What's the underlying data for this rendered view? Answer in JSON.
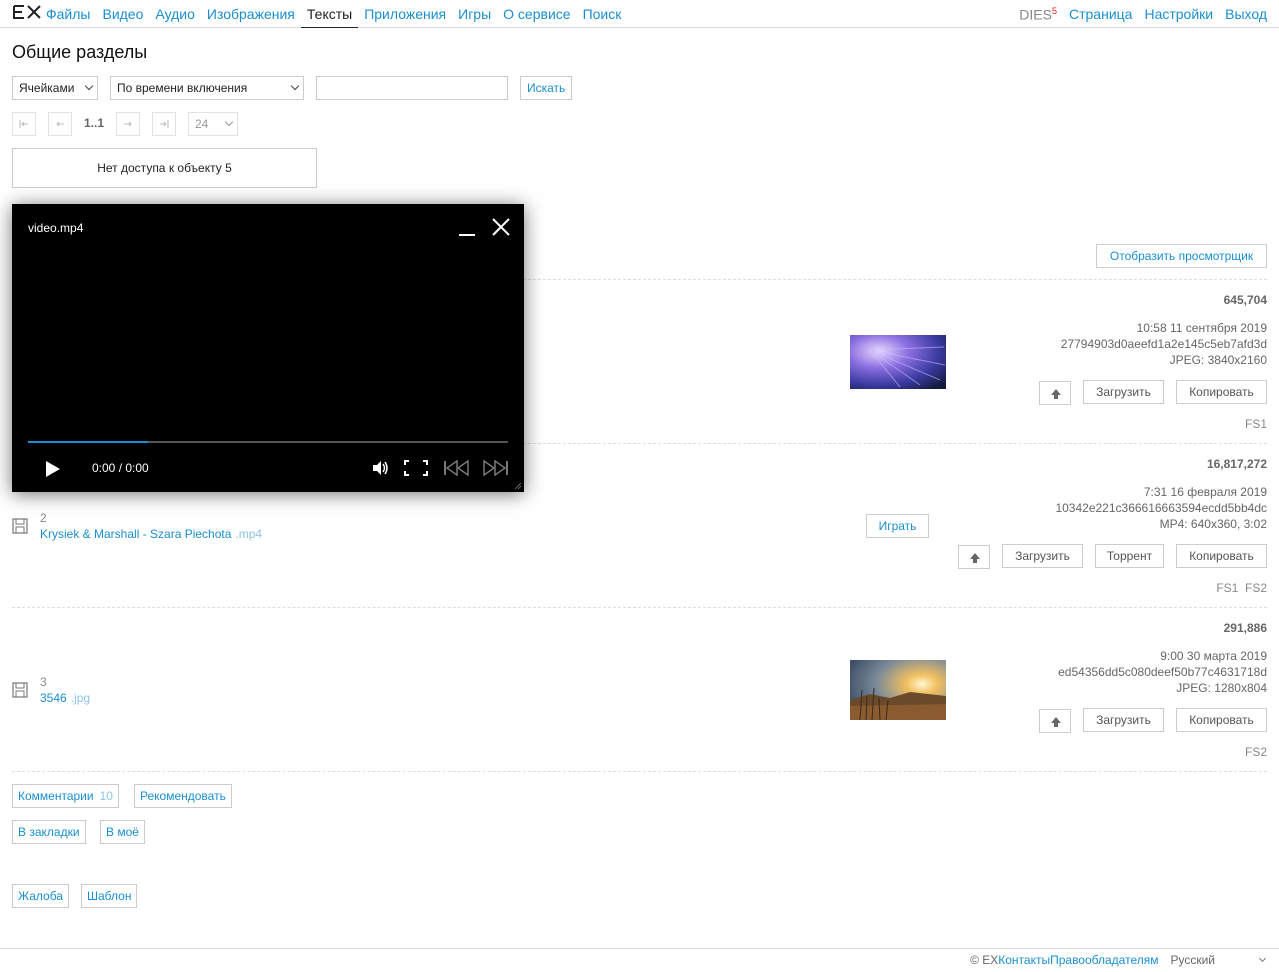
{
  "nav": {
    "logo": "EX",
    "items": [
      "Файлы",
      "Видео",
      "Аудио",
      "Изображения",
      "Тексты",
      "Приложения",
      "Игры",
      "О сервисе",
      "Поиск"
    ],
    "user": "DIES",
    "user_badge": "5",
    "right": [
      "Страница",
      "Настройки",
      "Выход"
    ]
  },
  "page_title": "Общие разделы",
  "filters": {
    "view": "Ячейками",
    "sort": "По времени включения",
    "search_value": "",
    "search_button": "Искать"
  },
  "pager": {
    "range": "1..1",
    "per_page": "24"
  },
  "noaccess": "Нет доступа к объекту 5",
  "viewer_button": "Отобразить просмотрщик",
  "player": {
    "title": "video.mp4",
    "time": "0:00 / 0:00",
    "progress": 0.25
  },
  "items": [
    {
      "size": "645,704",
      "date": "10:58 11 сентября 2019",
      "hash": "27794903d0aeefd1a2e145c5eb7afd3d",
      "info": "JPEG: 3840x2160",
      "buttons": [
        "Загрузить",
        "Копировать"
      ],
      "fs": "FS1"
    },
    {
      "num": "2",
      "name": "Krysiek & Marshall - Szara Piechota",
      "ext": ".mp4",
      "play": "Играть",
      "size": "16,817,272",
      "date": "7:31 16 февраля 2019",
      "hash": "10342e221c366616663594ecdd5bb4dc",
      "info": "MP4: 640x360, 3:02",
      "buttons": [
        "Загрузить",
        "Торрент",
        "Копировать"
      ],
      "fs": "FS1  FS2"
    },
    {
      "num": "3",
      "name": "3546",
      "ext": ".jpg",
      "size": "291,886",
      "date": "9:00 30 марта 2019",
      "hash": "ed54356dd5c080deef50b77c4631718d",
      "info": "JPEG: 1280x804",
      "buttons": [
        "Загрузить",
        "Копировать"
      ],
      "fs": "FS2"
    }
  ],
  "actions": {
    "comments": "Комментарии",
    "comments_count": "10",
    "recommend": "Рекомендовать",
    "bookmarks": "В закладки",
    "mine": "В моё",
    "report": "Жалоба",
    "template": "Шаблон"
  },
  "footer": [
    "© EX",
    "Контакты",
    "Правообладателям",
    "Русский"
  ]
}
